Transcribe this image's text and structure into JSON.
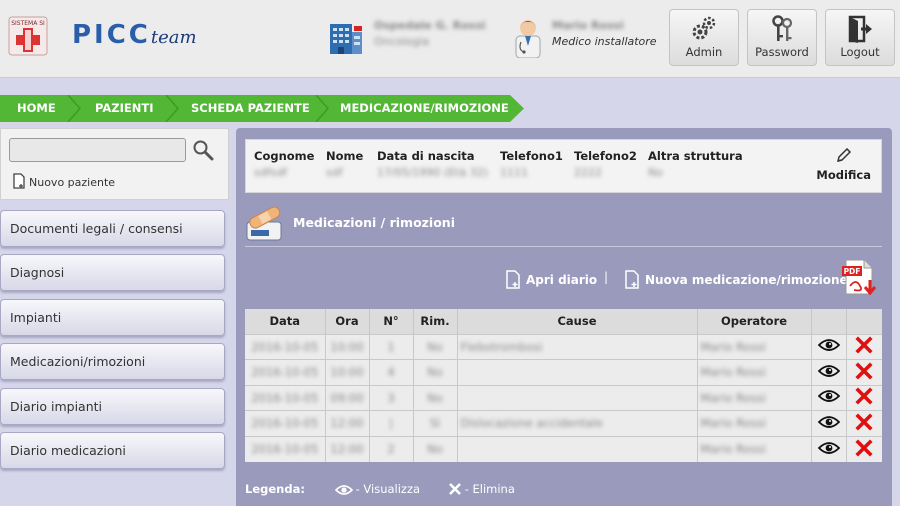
{
  "header": {
    "brand_part1": "PICC",
    "brand_part2": "team",
    "badge_text": "SISTEMA SI",
    "hospital_name": "Ospedale G. Rossi",
    "hospital_dept": "Oncologia",
    "doctor_name": "Mario Rossi",
    "doctor_role": "Medico installatore",
    "buttons": [
      {
        "label": "Admin",
        "icon": "gears-icon"
      },
      {
        "label": "Password",
        "icon": "keys-icon"
      },
      {
        "label": "Logout",
        "icon": "logout-icon"
      }
    ]
  },
  "breadcrumb": [
    "HOME",
    "PAZIENTI",
    "SCHEDA PAZIENTE",
    "MEDICAZIONE/RIMOZIONE"
  ],
  "sidebar": {
    "search_placeholder": "",
    "new_patient_label": "Nuovo paziente",
    "items": [
      {
        "label": "Documenti legali / consensi"
      },
      {
        "label": "Diagnosi"
      },
      {
        "label": "Impianti"
      },
      {
        "label": "Medicazioni/rimozioni"
      },
      {
        "label": "Diario impianti"
      },
      {
        "label": "Diario medicazioni"
      }
    ]
  },
  "patient": {
    "columns": [
      {
        "header": "Cognome",
        "value": "sdfsdf"
      },
      {
        "header": "Nome",
        "value": "sdf"
      },
      {
        "header": "Data di nascita",
        "value": "17/05/1990 (Età 32)"
      },
      {
        "header": "Telefono1",
        "value": "1111"
      },
      {
        "header": "Telefono2",
        "value": "2222"
      },
      {
        "header": "Altra struttura",
        "value": "No"
      }
    ],
    "edit_label": "Modifica"
  },
  "section": {
    "title": "Medicazioni / rimozioni",
    "open_diary_label": "Apri diario",
    "separator": "|",
    "new_label": "Nuova medicazione/rimozione"
  },
  "table": {
    "headers": [
      "Data",
      "Ora",
      "N°",
      "Rim.",
      "Cause",
      "Operatore"
    ],
    "rows": [
      [
        "2016-10-05",
        "10:00",
        "1",
        "No",
        "Flebotrombosi",
        "Mario Rossi"
      ],
      [
        "2016-10-05",
        "10:00",
        "4",
        "No",
        "",
        "Mario Rossi"
      ],
      [
        "2016-10-05",
        "09:00",
        "3",
        "No",
        "",
        "Mario Rossi"
      ],
      [
        "2016-10-05",
        "12:00",
        "|",
        "Sì",
        "Dislocazione accidentale",
        "Mario Rossi"
      ],
      [
        "2016-10-05",
        "12:00",
        "2",
        "No",
        "",
        "Mario Rossi"
      ]
    ]
  },
  "legend": {
    "label": "Legenda:",
    "view": "- Visualizza",
    "delete": "- Elimina"
  },
  "colors": {
    "accent_green": "#52b734",
    "panel": "#9a9abd",
    "background": "#d6d6ea",
    "delete_red": "#e01010"
  }
}
